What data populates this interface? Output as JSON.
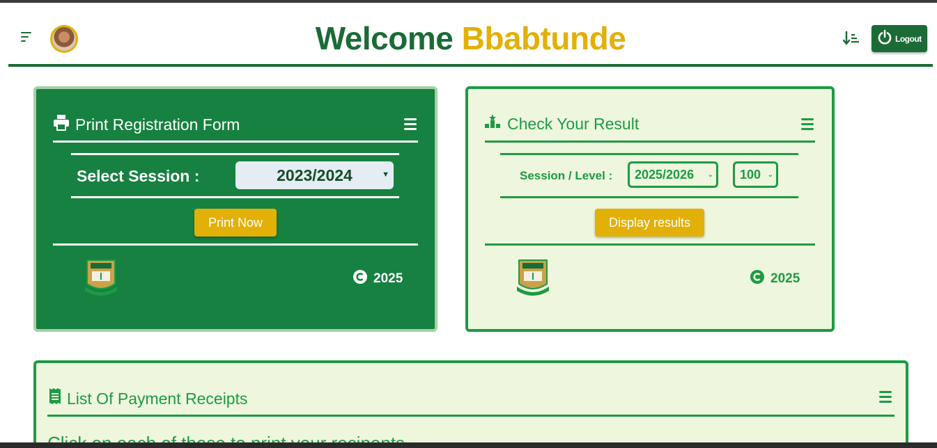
{
  "header": {
    "welcome_prefix": "Welcome",
    "user_name": "Bbabtunde",
    "logout_label": "Logout"
  },
  "print_card": {
    "title": "Print Registration Form",
    "select_label": "Select Session :",
    "session_value": "2023/2024",
    "button_label": "Print Now",
    "copyright_year": "2025"
  },
  "result_card": {
    "title": "Check Your Result",
    "select_label": "Session / Level :",
    "session_value": "2025/2026",
    "level_value": "100",
    "button_label": "Display results",
    "copyright_year": "2025"
  },
  "payment_card": {
    "title": "List Of Payment Receipts",
    "note": "Click on each of these to print your recipents"
  },
  "colors": {
    "primary_green": "#1b6b36",
    "card_green": "#168140",
    "accent_green": "#1d9a44",
    "accent_yellow": "#e2b007",
    "card_light": "#eef6dd"
  },
  "icons": [
    "menu-icon",
    "avatar",
    "sort-icon",
    "power-icon",
    "printer-icon",
    "chart-icon",
    "receipt-icon",
    "hamburger-icon",
    "copyright-icon",
    "university-logo"
  ]
}
